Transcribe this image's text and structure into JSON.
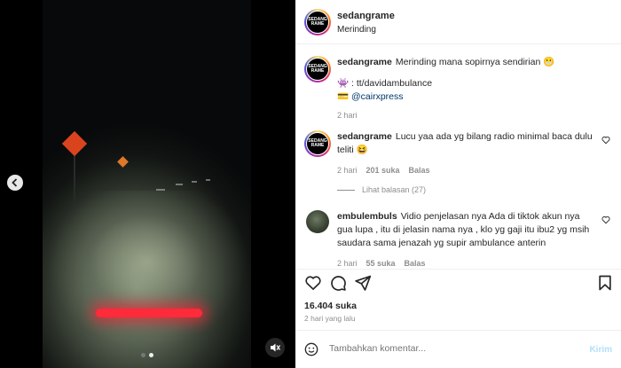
{
  "post": {
    "username": "sedangrame",
    "location": "Merinding",
    "avatar_text": [
      "SEDANG",
      "RAME"
    ]
  },
  "caption": {
    "username": "sedangrame",
    "text": "Merinding mana sopirnya sendirian 😬",
    "credit_line": "👾 : tt/davidambulance",
    "credit_handle_prefix": "💳 ",
    "credit_handle": "@cairxpress",
    "time": "2 hari"
  },
  "comments": [
    {
      "username": "sedangrame",
      "text": "Lucu yaa ada yg bilang radio minimal baca dulu teliti 😆",
      "time": "2 hari",
      "likes": "201 suka",
      "reply": "Balas"
    },
    {
      "username": "embulembuls",
      "text": "Vidio penjelasan nya Ada di tiktok akun nya gua lupa , itu di jelasin nama nya , klo yg gaji itu ibu2 yg msih saudara sama jenazah yg supir ambulance anterin",
      "time": "2 hari",
      "likes": "55 suka",
      "reply": "Balas"
    }
  ],
  "view_replies": "Lihat balasan (27)",
  "likes_total": "16.404 suka",
  "posted_time": "2 hari yang lalu",
  "add_comment": {
    "placeholder": "Tambahkan komentar...",
    "post_label": "Kirim"
  },
  "media": {
    "carousel_count": 2,
    "carousel_active": 2
  },
  "colors": {
    "link": "#00376b",
    "muted": "#8e8e8e",
    "post_button": "#b2dffc",
    "taillight": "#ff2a3a"
  }
}
